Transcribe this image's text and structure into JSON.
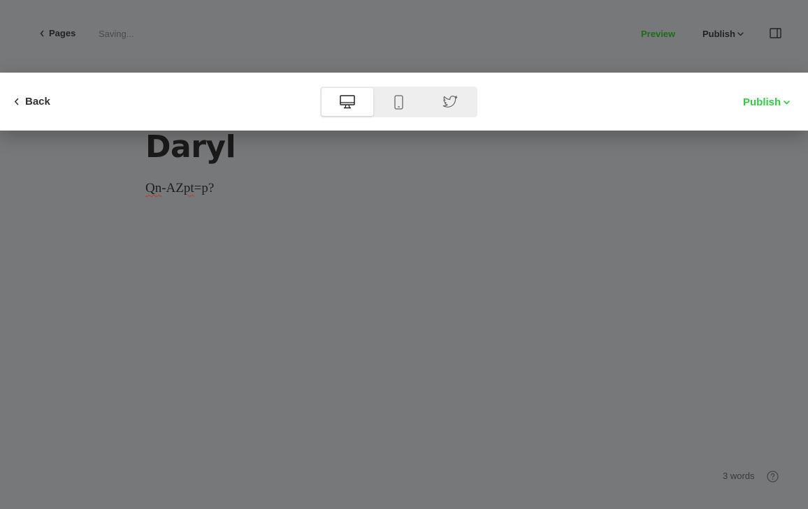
{
  "editor": {
    "pages_label": "Pages",
    "status": "Saving...",
    "preview_label": "Preview",
    "publish_label": "Publish",
    "post": {
      "title": "Daryl",
      "body_parts": [
        "Qn",
        "-AZ",
        "pt",
        "=p?"
      ]
    },
    "word_count": "3 words"
  },
  "modal": {
    "back_label": "Back",
    "devices": [
      {
        "name": "desktop-icon",
        "active": true
      },
      {
        "name": "mobile-icon",
        "active": false
      },
      {
        "name": "twitter-icon",
        "active": false
      }
    ],
    "publish_label": "Publish"
  },
  "colors": {
    "accent_green": "#30cf43",
    "preview_green": "#1e6b1e",
    "overlay": "#77787a",
    "bar_bg": "#ffffff"
  }
}
